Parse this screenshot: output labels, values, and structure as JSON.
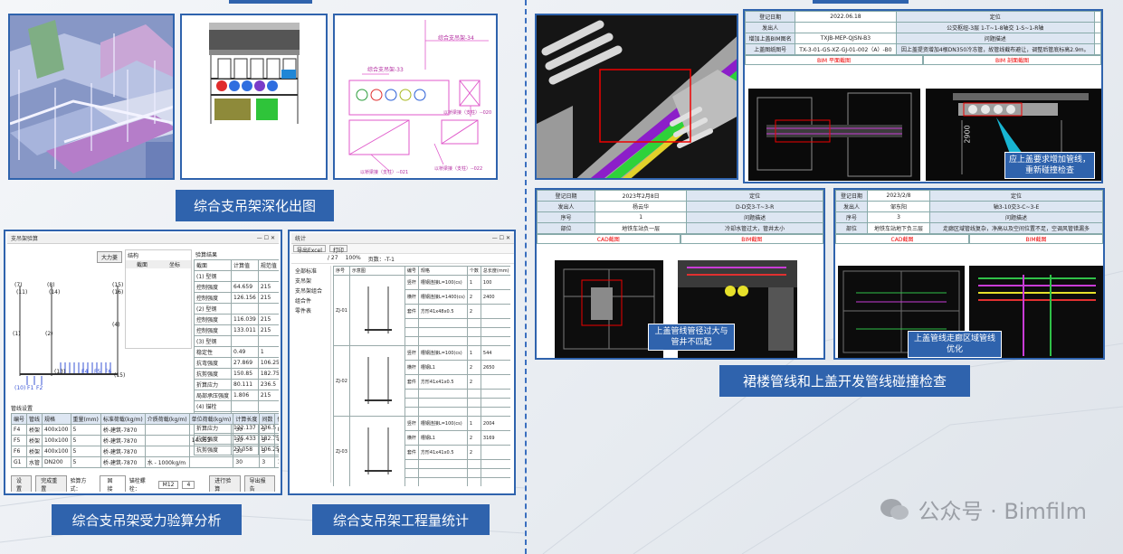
{
  "captions": {
    "deepening": "综合支吊架深化出图",
    "stress": "综合支吊架受力验算分析",
    "quantity": "综合支吊架工程量统计",
    "collision": "裙楼管线和上盖开发管线碰撞检查"
  },
  "watermark": {
    "text": "公众号 · Bimfilm"
  },
  "drawing_labels": {
    "label_34": "综合支吊架-34",
    "label_33": "综合支吊架-33",
    "label_020": "以桥梁接（支柱）--020",
    "label_021": "以桥梁接（支柱）--021",
    "label_022": "以桥梁接（支柱）--022"
  },
  "stress_window": {
    "title": "支吊架验算",
    "btn_large": "大力菱",
    "group_title": "结构",
    "group_header": [
      "截面",
      "坐标"
    ],
    "calc_title": "验算结果",
    "calc_headers": [
      "截面",
      "计算值",
      "规范值",
      "结果"
    ],
    "calc_rows": [
      [
        "(1) 型钢",
        "",
        "",
        ""
      ],
      [
        "控制强度",
        "64.659",
        "215",
        "满足"
      ],
      [
        "控制强度",
        "126.156",
        "215",
        "满足"
      ],
      [
        "(2) 型钢",
        "",
        "",
        ""
      ],
      [
        "控制强度",
        "116.039",
        "215",
        "满足"
      ],
      [
        "控制强度",
        "133.011",
        "215",
        "满足"
      ],
      [
        "(3) 型钢",
        "",
        "",
        ""
      ],
      [
        "稳定性",
        "0.49",
        "1",
        "满足"
      ],
      [
        "抗弯强度",
        "27.869",
        "106.25",
        "满足"
      ],
      [
        "抗剪强度",
        "150.85",
        "182.75",
        "满足"
      ],
      [
        "折算应力",
        "80.111",
        "236.5",
        "满足"
      ],
      [
        "局部承压强度",
        "1.806",
        "215",
        "满足"
      ],
      [
        "(4) 锚栓",
        "",
        "",
        ""
      ],
      [
        "稳定性",
        "0.696",
        "1",
        "满足"
      ],
      [
        "折算应力",
        "122.137",
        "236.5",
        "满足"
      ],
      [
        "抗剪强度",
        "175.433",
        "182.75",
        "满足"
      ],
      [
        "抗剪强度",
        "27.058",
        "106.25",
        "满足"
      ]
    ],
    "pipe_title": "管线设置",
    "pipe_headers": [
      "编号",
      "管线",
      "规格",
      "重量(mm)",
      "标准荷载(kg/m)",
      "介质荷载(kg/m)",
      "单位荷载(kg/m)",
      "计算长度",
      "间数",
      "修正"
    ],
    "pipe_rows": [
      [
        "F4",
        "桥架",
        "400x100",
        "5",
        "桥-建筑-7870",
        "",
        "",
        "30",
        "3",
        "882"
      ],
      [
        "F5",
        "桥架",
        "100x100",
        "5",
        "桥-建筑-7870",
        "",
        "14.053",
        "30",
        "3",
        "436.618"
      ],
      [
        "F6",
        "桥架",
        "400x100",
        "5",
        "桥-建筑-7870",
        "",
        "",
        "30",
        "3",
        "882"
      ],
      [
        "G1",
        "水管",
        "DN200",
        "5",
        "桥-建筑-7870",
        "水 - 1000kg/m",
        "",
        "30",
        "3",
        "1470"
      ]
    ],
    "bottom": {
      "settings": "设置",
      "reset": "完成重置",
      "label_method": "验算方式：",
      "method_value": "固接",
      "label_anchor": "锚栓螺栓：",
      "anchor_value": "M12",
      "anchor_count": "4",
      "btn_report": "进行验算",
      "btn_export": "导出报告"
    },
    "diagram_labels": [
      "(7)",
      "(8)",
      "(11)",
      "(14)",
      "(15)",
      "(16)",
      "(1)",
      "(2)",
      "(3)",
      "(4)",
      "(13)",
      "(15)",
      "(10)",
      "(12)",
      "F1",
      "F2",
      "F4",
      "F5",
      "F6",
      "G1"
    ]
  },
  "quantity_window": {
    "title": "统计",
    "toolbar": [
      "导出Excel",
      "打印"
    ],
    "page": "/ 27",
    "zoom": "100%",
    "page_label": "页数：-T-1",
    "tree": [
      "全部标准",
      "支吊架",
      "支吊架组合",
      "组合件",
      "零件表"
    ],
    "headers": [
      "序号",
      "示意图",
      "编号",
      "规格",
      "个数",
      "总长度(mm)"
    ],
    "rows": [
      {
        "id": "ZJ-01",
        "items": [
          [
            "竖杆",
            "槽钢连接L=100(cs)",
            "1",
            "100"
          ],
          [
            "横杆",
            "槽钢连接L=1400(cs)",
            "2",
            "2400"
          ],
          [
            "套件",
            "方形41x48x0.5",
            "2",
            ""
          ]
        ]
      },
      {
        "id": "ZJ-02",
        "items": [
          [
            "竖杆",
            "槽钢连接L=100(cs)",
            "1",
            "544"
          ],
          [
            "横杆",
            "槽钢L1",
            "2",
            "2650"
          ],
          [
            "套件",
            "方形41x41x0.5",
            "2",
            ""
          ]
        ]
      },
      {
        "id": "ZJ-03",
        "items": [
          [
            "竖杆",
            "槽钢连接L=100(cs)",
            "1",
            "2004"
          ],
          [
            "横杆",
            "槽钢L1",
            "2",
            "3169"
          ],
          [
            "套件",
            "方形41x41x0.5",
            "2",
            ""
          ]
        ]
      }
    ]
  },
  "collision1": {
    "rows": [
      [
        "登记日期",
        "2022.06.18",
        "定位",
        ""
      ],
      [
        "发出人",
        "",
        "公交枢纽-3层 1-T~1-8轴交 1-S~1-R轴",
        ""
      ],
      [
        "增加上盖BIM图名",
        "TXJB-MEP-QJSN-B3",
        "问题描述",
        ""
      ],
      [
        "上盖图纸图号",
        "TX-3-01-GS-XZ-GJ-01-002（A）-B0",
        "因上盖提资增加4根DN350冷冻管，故管线截布避让，调整后管底标高2.9m。",
        ""
      ]
    ],
    "sub_left": "BIM 平面截图",
    "sub_right": "BIM 剖面截图",
    "callout": "应上盖要求增加管线，重新碰撞检查",
    "dim": "2900"
  },
  "collision2": {
    "rows": [
      [
        "登记日期",
        "2023年2月8日",
        "定位"
      ],
      [
        "发出人",
        "杨云华",
        "D-D交3-T~3-R"
      ],
      [
        "序号",
        "1",
        "问题描述"
      ],
      [
        "部位",
        "地铁车站负一层",
        "冷却水管过大，管井太小"
      ]
    ],
    "sub_left": "CAD截图",
    "sub_right": "BIM截图",
    "callout": "上盖管线管径过大与管井不匹配"
  },
  "collision3": {
    "rows": [
      [
        "登记日期",
        "2023/2/8",
        "定位"
      ],
      [
        "发出人",
        "邹东阳",
        "轴3-10交3-C~3-E"
      ],
      [
        "序号",
        "3",
        "问题描述"
      ],
      [
        "部位",
        "地铁车站地下负三层",
        "走廊区域管线复杂，净高以及空间位置不足，空调风管错漏多"
      ]
    ],
    "sub_left": "CAD截图",
    "sub_right": "BIM截图",
    "callout": "上盖管线走廊区域管线优化"
  },
  "colors": {
    "brand": "#2f63ad",
    "accent_red": "#e00000",
    "purple": "#8b2bd9",
    "green": "#2fc43a"
  }
}
